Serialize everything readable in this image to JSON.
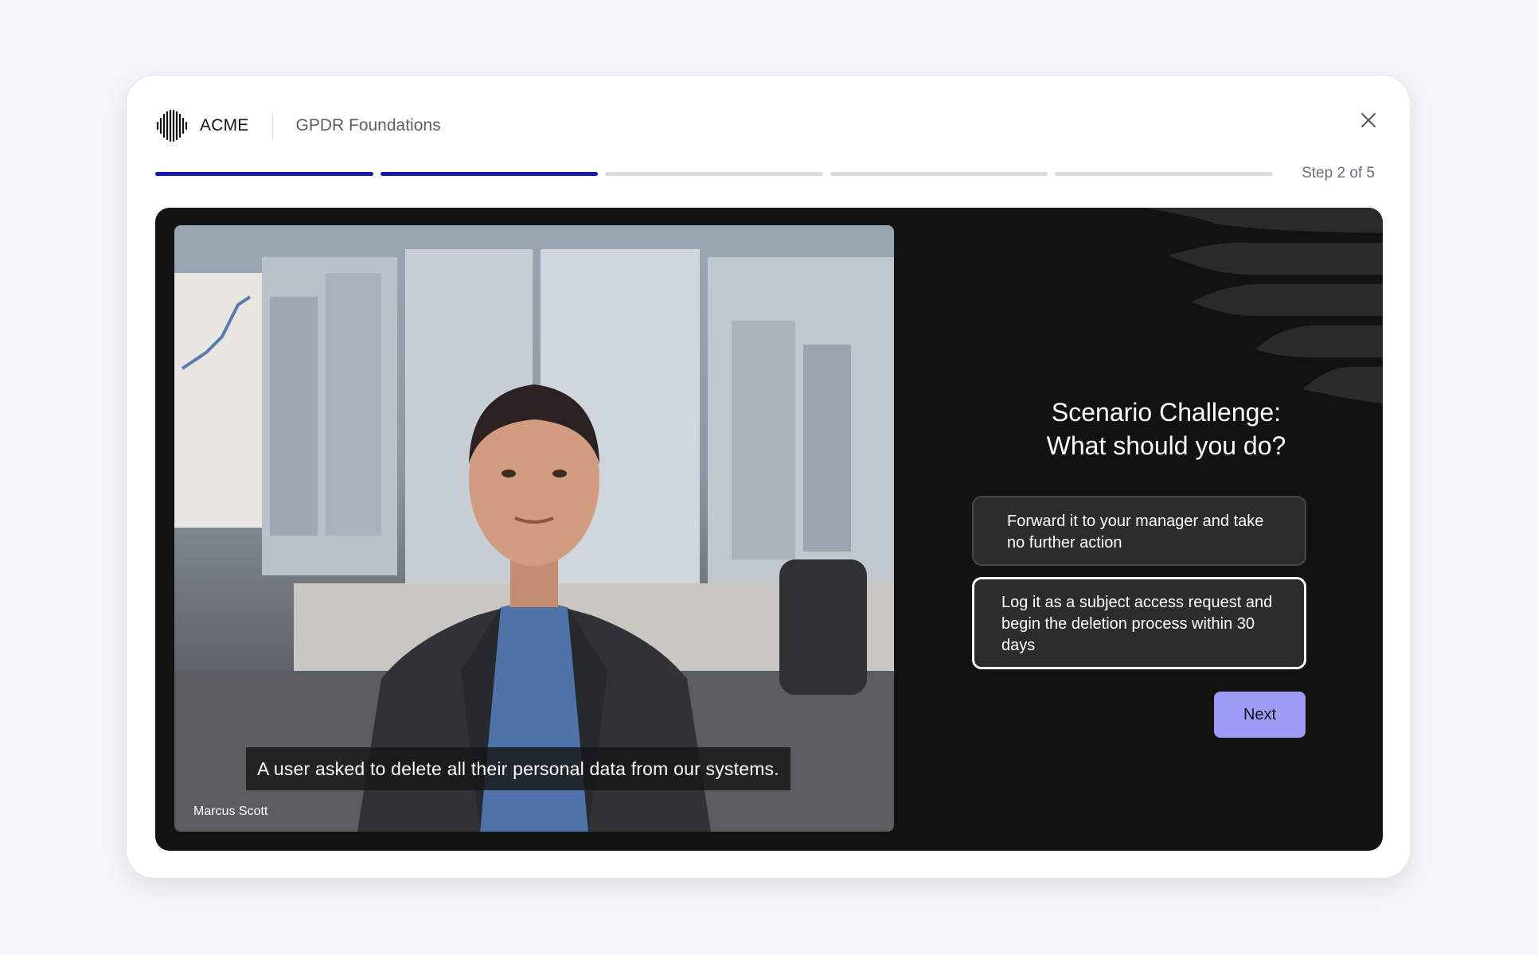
{
  "header": {
    "brand": "ACME",
    "course_title": "GPDR Foundations",
    "logo_icon": "waveform-logo-icon",
    "close_icon": "close-icon"
  },
  "progress": {
    "current_step": 2,
    "total_steps": 5,
    "label": "Step 2 of 5",
    "active_color": "#1717b0",
    "inactive_color": "#dcdcd6"
  },
  "video": {
    "caption": "A user asked to delete all their personal data from our systems.",
    "speaker": "Marcus Scott"
  },
  "challenge": {
    "title_line1": "Scenario Challenge:",
    "title_line2": "What should you do?",
    "options": [
      {
        "label": "Forward it to your manager and take no further action",
        "selected": false
      },
      {
        "label": "Log it as a subject access request and begin the deletion process within 30 days",
        "selected": true
      }
    ],
    "next_label": "Next",
    "next_color": "#9f9cf7"
  }
}
